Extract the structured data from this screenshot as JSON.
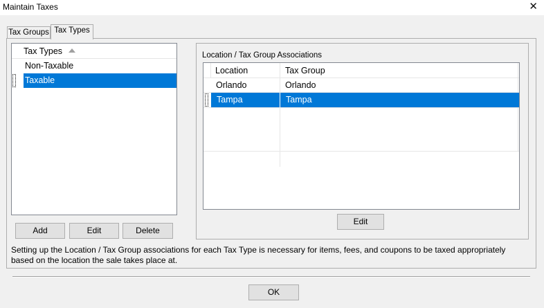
{
  "window": {
    "title": "Maintain Taxes",
    "close_glyph": "✕"
  },
  "tabs": [
    {
      "label": "Tax Groups"
    },
    {
      "label": "Tax Types"
    }
  ],
  "tax_types": {
    "column_header": "Tax Types",
    "items": [
      {
        "label": "Non-Taxable"
      },
      {
        "label": "Taxable"
      }
    ],
    "selected_index": 1,
    "buttons": {
      "add": "Add",
      "edit": "Edit",
      "delete": "Delete"
    }
  },
  "associations": {
    "group_label": "Location / Tax Group Associations",
    "columns": [
      "Location",
      "Tax Group"
    ],
    "rows": [
      {
        "location": "Orlando",
        "tax_group": "Orlando"
      },
      {
        "location": "Tampa",
        "tax_group": "Tampa"
      }
    ],
    "selected_index": 1,
    "edit_button": "Edit"
  },
  "info_text": "Setting up the Location / Tax Group associations for each Tax Type is necessary for items, fees, and coupons to be taxed appropriately based on the location the sale takes place at.",
  "ok_button": "OK",
  "colors": {
    "selection": "#0078d7",
    "dialog_bg": "#f0f0f0"
  }
}
